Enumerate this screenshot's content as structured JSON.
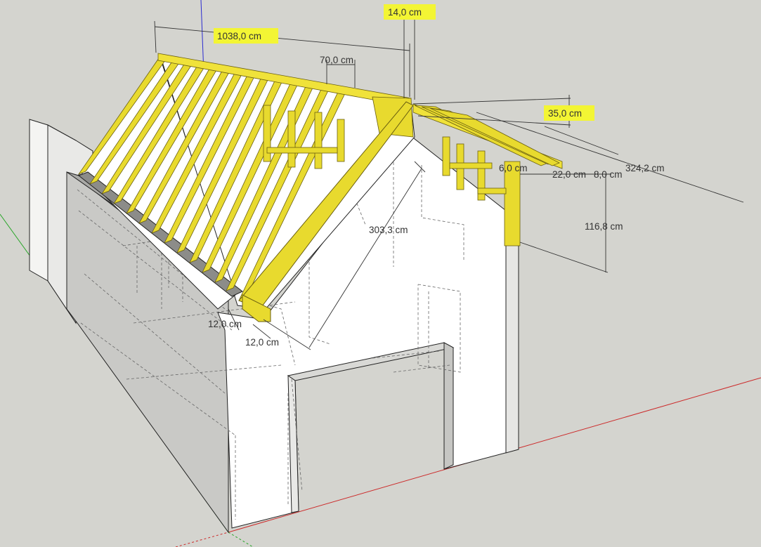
{
  "viewport": {
    "background": "#d4d4cf",
    "model": "garage with timber roof framing",
    "axes": {
      "red": "#cc2a2a",
      "green": "#2aa62a",
      "blue": "#2a2ad0"
    }
  },
  "colors": {
    "timber": "#e8da2e",
    "timber_dark": "#b3a41b",
    "highlight": "#f3f534",
    "wall": "#ffffff",
    "wall_shadow": "#c9c9c6",
    "line": "#222222"
  },
  "dimensions": {
    "ridge_length": "1038,0 cm",
    "ridge_beam_width": "14,0 cm",
    "rafter_spacing": "70,0 cm",
    "overhang": "35,0 cm",
    "span_diagonal": "324,2 cm",
    "rafter_section_a": "22,0 cm",
    "rafter_section_b": "8,0 cm",
    "small_member": "6,0 cm",
    "knee_wall_height": "116,8 cm",
    "rafter_length": "303,3 cm",
    "wall_plate_height": "12,0 cm",
    "wall_plate_width": "12,0 cm"
  }
}
